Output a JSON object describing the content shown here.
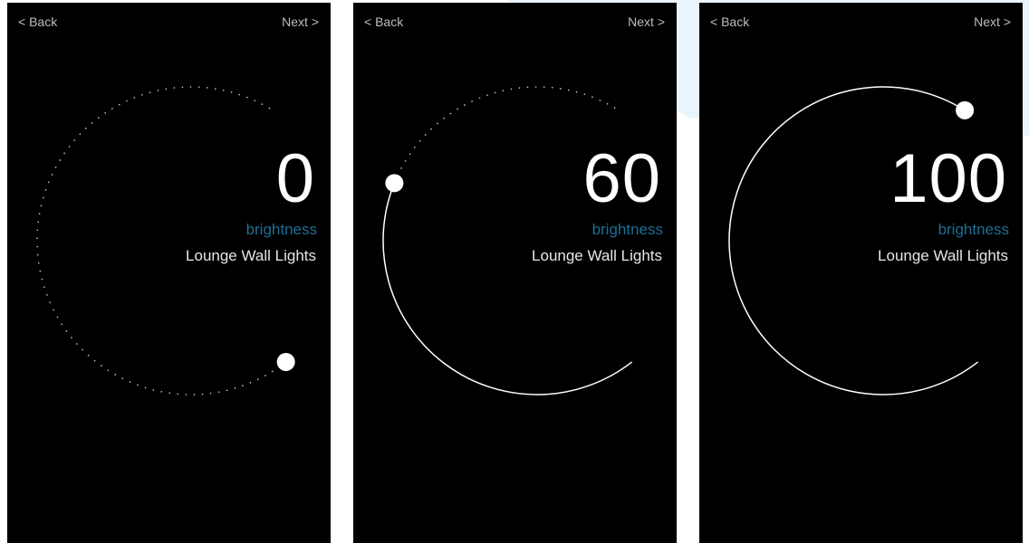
{
  "colors": {
    "screen_background": "#000000",
    "accent_label": "#1c6f96",
    "dial_track": "#ffffff",
    "page_background_tint": "#e8f5fc"
  },
  "icons": {
    "dial_handle": "knob-icon"
  },
  "screens": [
    {
      "nav": {
        "back_label": "< Back",
        "next_label": "Next >"
      },
      "value": "0",
      "level_percent": 0,
      "label": "brightness",
      "device": "Lounge Wall Lights"
    },
    {
      "nav": {
        "back_label": "< Back",
        "next_label": "Next >"
      },
      "value": "60",
      "level_percent": 60,
      "label": "brightness",
      "device": "Lounge Wall Lights"
    },
    {
      "nav": {
        "back_label": "< Back",
        "next_label": "Next >"
      },
      "value": "100",
      "level_percent": 100,
      "label": "brightness",
      "device": "Lounge Wall Lights"
    }
  ]
}
